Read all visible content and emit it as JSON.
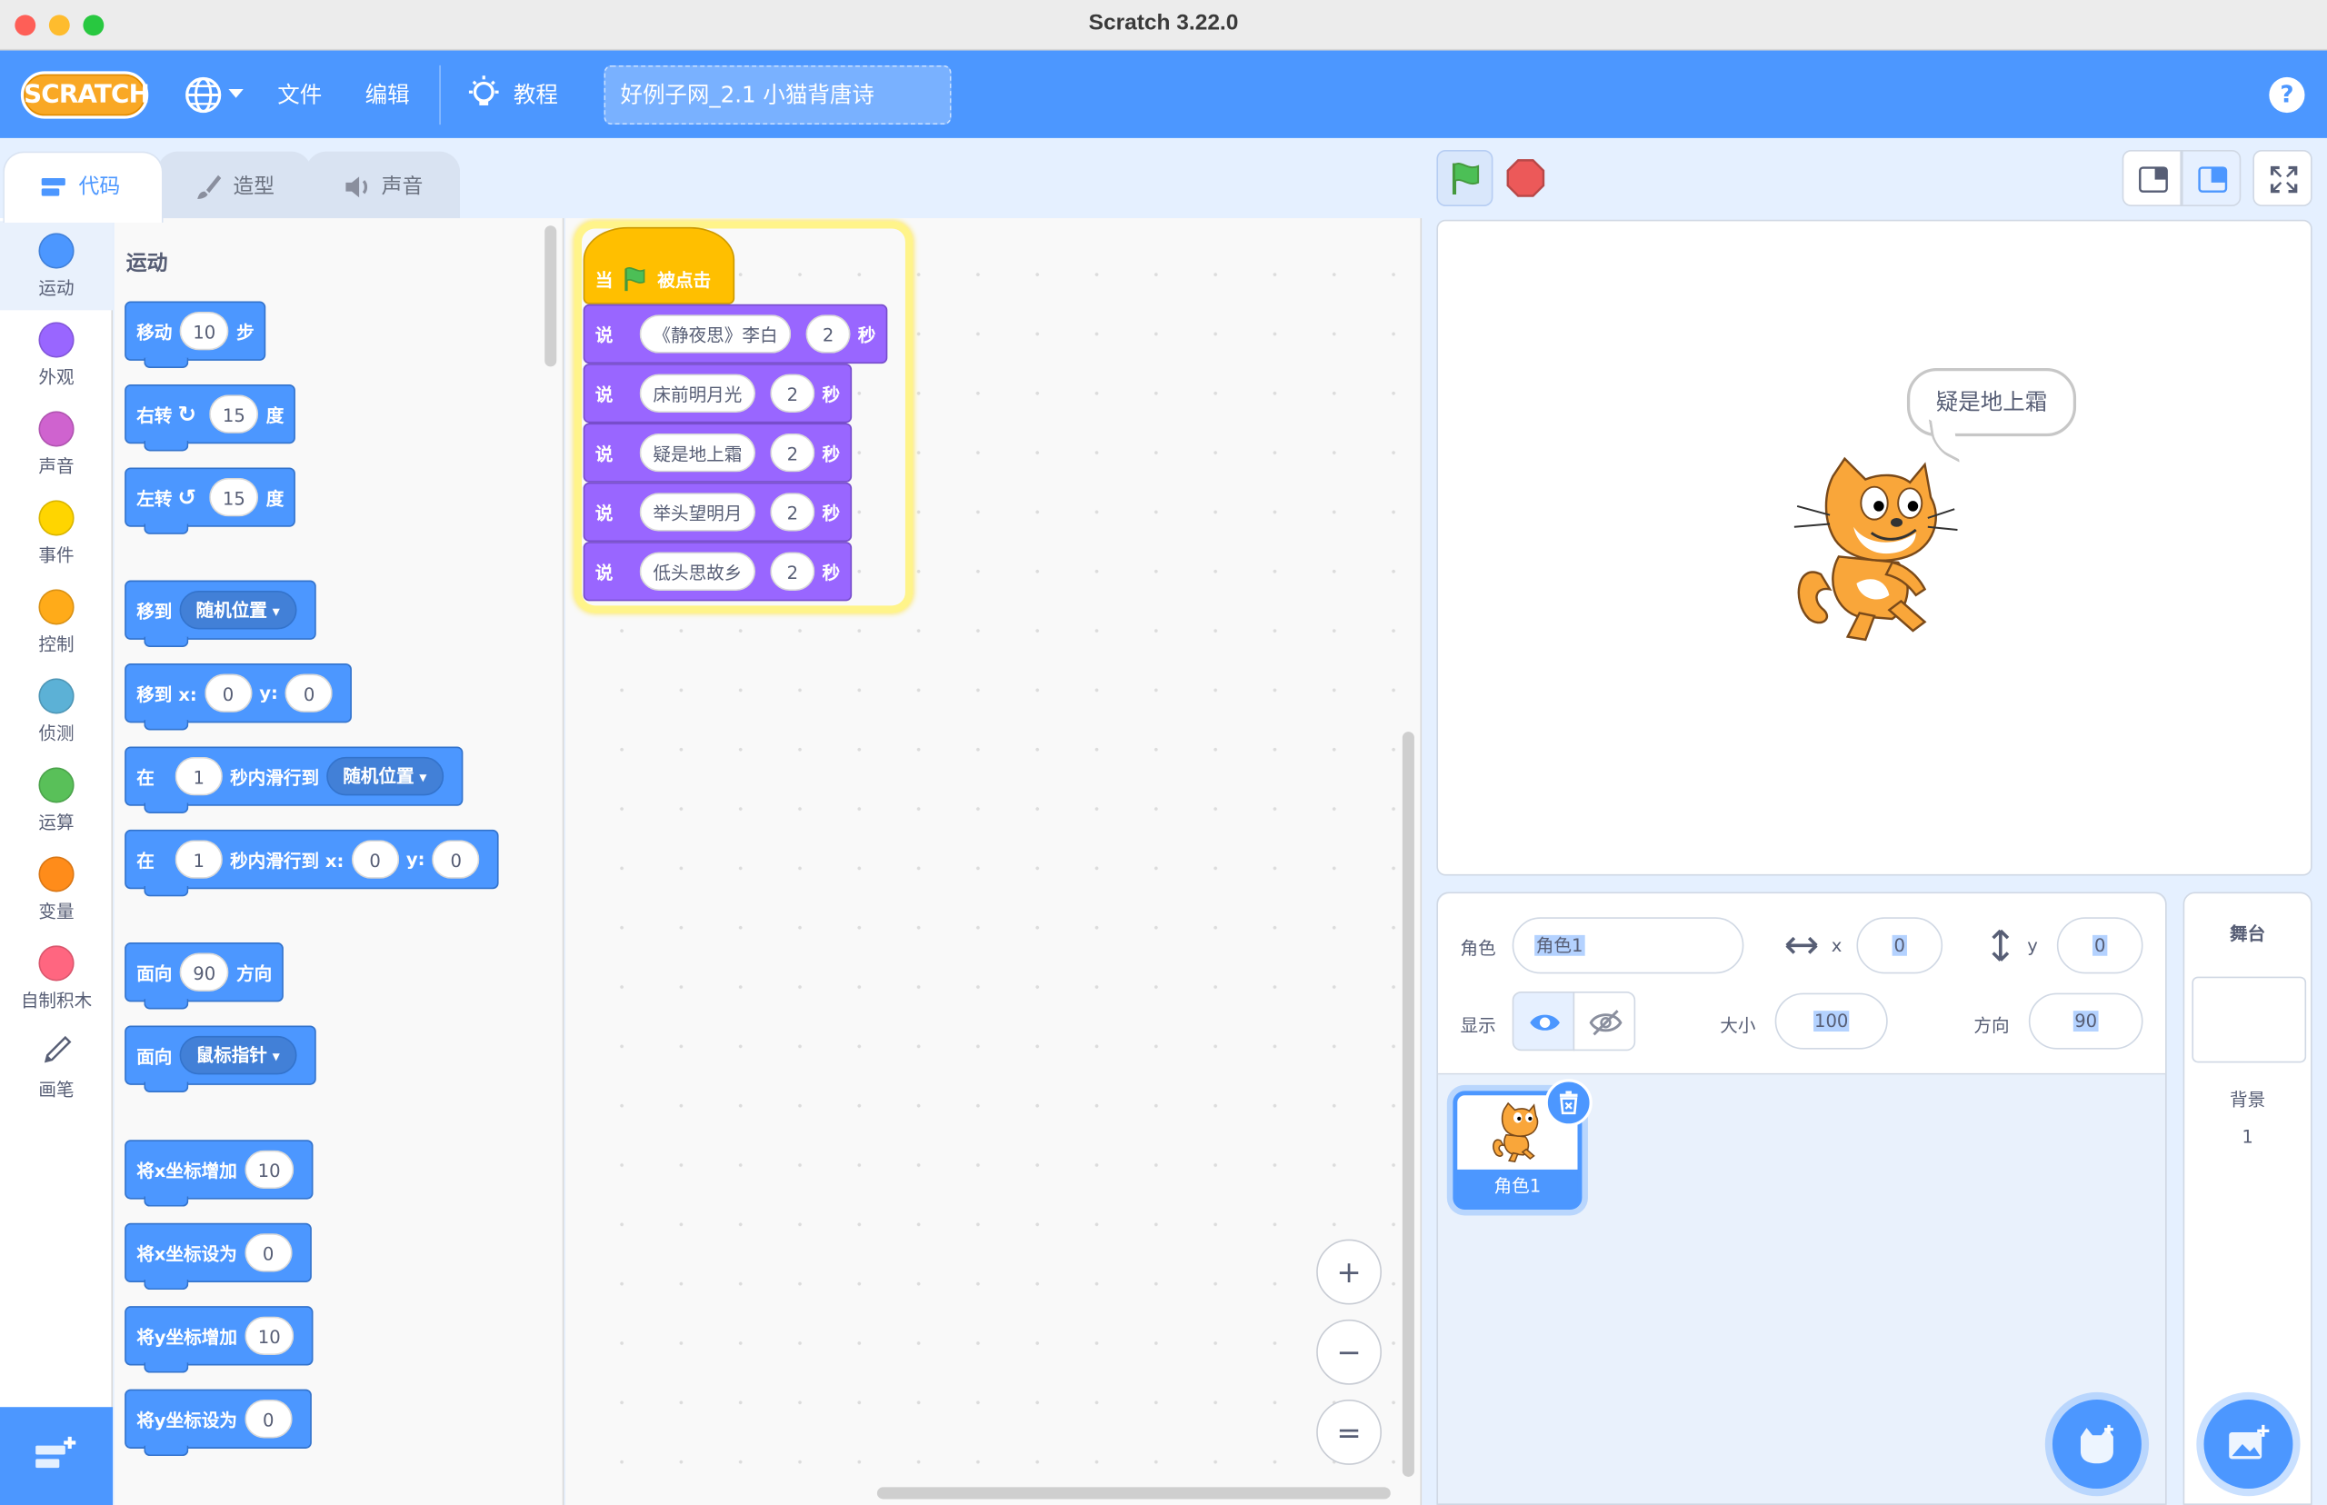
{
  "window": {
    "title": "Scratch 3.22.0"
  },
  "menubar": {
    "logo": "SCRATCH",
    "file": "文件",
    "edit": "编辑",
    "tutorials": "教程",
    "project_title": "好例子网_2.1 小猫背唐诗",
    "help": "?"
  },
  "tabs": {
    "code": "代码",
    "costumes": "造型",
    "sounds": "声音"
  },
  "categories": [
    {
      "label": "运动",
      "color": "#4c97ff"
    },
    {
      "label": "外观",
      "color": "#9966ff"
    },
    {
      "label": "声音",
      "color": "#cf63cf"
    },
    {
      "label": "事件",
      "color": "#ffd500"
    },
    {
      "label": "控制",
      "color": "#ffab19"
    },
    {
      "label": "侦测",
      "color": "#5cb1d6"
    },
    {
      "label": "运算",
      "color": "#59c059"
    },
    {
      "label": "变量",
      "color": "#ff8c1a"
    },
    {
      "label": "自制积木",
      "color": "#ff6680"
    },
    {
      "label": "画笔",
      "color": "#0fbd8c"
    }
  ],
  "palette": {
    "title": "运动",
    "move": {
      "a": "移动",
      "v": "10",
      "b": "步"
    },
    "turn_right": {
      "a": "右转",
      "v": "15",
      "b": "度"
    },
    "turn_left": {
      "a": "左转",
      "v": "15",
      "b": "度"
    },
    "goto": {
      "a": "移到",
      "dd": "随机位置"
    },
    "goto_xy": {
      "a": "移到 x:",
      "x": "0",
      "yl": "y:",
      "y": "0"
    },
    "glide": {
      "a": "在",
      "v": "1",
      "b": "秒内滑行到",
      "dd": "随机位置"
    },
    "glide_xy": {
      "a": "在",
      "v": "1",
      "b": "秒内滑行到 x:",
      "x": "0",
      "yl": "y:",
      "y": "0"
    },
    "point_dir": {
      "a": "面向",
      "v": "90",
      "b": "方向"
    },
    "point_towards": {
      "a": "面向",
      "dd": "鼠标指针"
    },
    "change_x": {
      "a": "将x坐标增加",
      "v": "10"
    },
    "set_x": {
      "a": "将x坐标设为",
      "v": "0"
    },
    "change_y": {
      "a": "将y坐标增加",
      "v": "10"
    },
    "set_y": {
      "a": "将y坐标设为",
      "v": "0"
    }
  },
  "script": {
    "hat": {
      "a": "当",
      "b": "被点击"
    },
    "say_label": "说",
    "sec_label": "秒",
    "lines": [
      {
        "text": "《静夜思》李白",
        "secs": "2"
      },
      {
        "text": "床前明月光",
        "secs": "2"
      },
      {
        "text": "疑是地上霜",
        "secs": "2"
      },
      {
        "text": "举头望明月",
        "secs": "2"
      },
      {
        "text": "低头思故乡",
        "secs": "2"
      }
    ]
  },
  "zoom": {
    "in": "+",
    "out": "−",
    "reset": "="
  },
  "stage": {
    "bubble": "疑是地上霜"
  },
  "sprite_info": {
    "sprite_label": "角色",
    "sprite_name": "角色1",
    "x_label": "x",
    "x": "0",
    "y_label": "y",
    "y": "0",
    "show_label": "显示",
    "size_label": "大小",
    "size": "100",
    "direction_label": "方向",
    "direction": "90"
  },
  "sprites": [
    {
      "name": "角色1"
    }
  ],
  "stage_pane": {
    "title": "舞台",
    "backdrops_label": "背景",
    "backdrops_count": "1"
  }
}
